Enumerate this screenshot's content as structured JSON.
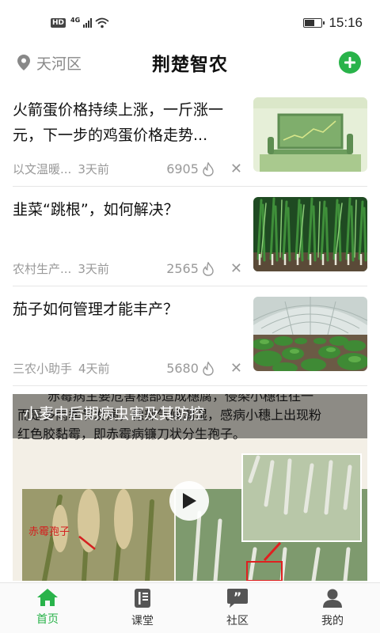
{
  "status_bar": {
    "hd": "HD",
    "network": "4G",
    "time": "15:16",
    "battery_level": 0.6
  },
  "header": {
    "location": "天河区",
    "title": "荆楚智农"
  },
  "news": [
    {
      "title": "火箭蛋价格持续上涨，一斤涨一元，下一步的鸡蛋价格走势...",
      "source": "以文温暖...",
      "time": "3天前",
      "views": "6905"
    },
    {
      "title": "韭菜“跳根”，如何解决？",
      "source": "农村生产...",
      "time": "3天前",
      "views": "2565"
    },
    {
      "title": "茄子如何管理才能丰产？",
      "source": "三农小助手",
      "time": "4天前",
      "views": "5680"
    }
  ],
  "video": {
    "title": "小麦中后期病虫害及其防控",
    "doc_text_1": "赤霉病主要危害穗部造成穗腐，侵染小穗往往一",
    "doc_text_2": "而是多雨季节发病，穗部气候潮湿，感病小穗上出现粉",
    "doc_text_3": "红色胶黏霉，即赤霉病镰刀状分生孢子。",
    "photo_label": "赤霉孢子"
  },
  "nav": [
    {
      "label": "首页",
      "icon": "home-icon",
      "active": true
    },
    {
      "label": "课堂",
      "icon": "book-icon",
      "active": false
    },
    {
      "label": "社区",
      "icon": "quote-chat-icon",
      "active": false
    },
    {
      "label": "我的",
      "icon": "person-icon",
      "active": false
    }
  ],
  "colors": {
    "brand_green": "#29b34a",
    "muted_text": "#999999"
  }
}
